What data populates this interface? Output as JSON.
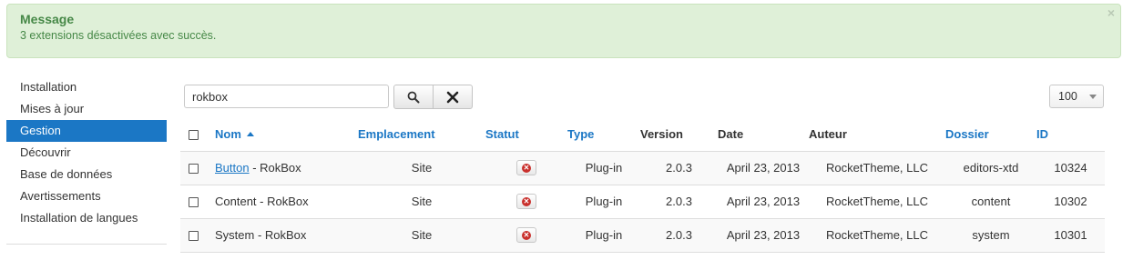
{
  "alert": {
    "heading": "Message",
    "message": "3 extensions désactivées avec succès.",
    "close": "×"
  },
  "sidebar": {
    "items": [
      {
        "label": "Installation",
        "active": false
      },
      {
        "label": "Mises à jour",
        "active": false
      },
      {
        "label": "Gestion",
        "active": true
      },
      {
        "label": "Découvrir",
        "active": false
      },
      {
        "label": "Base de données",
        "active": false
      },
      {
        "label": "Avertissements",
        "active": false
      },
      {
        "label": "Installation de langues",
        "active": false
      }
    ]
  },
  "search": {
    "value": "rokbox",
    "search_icon": "search-icon",
    "clear_icon": "close-icon"
  },
  "limit": {
    "value": "100"
  },
  "table": {
    "headers": {
      "name": "Nom",
      "location": "Emplacement",
      "status": "Statut",
      "type": "Type",
      "version": "Version",
      "date": "Date",
      "author": "Auteur",
      "folder": "Dossier",
      "id": "ID"
    },
    "rows": [
      {
        "name_link": "Button",
        "name_suffix": " - RokBox",
        "location": "Site",
        "type": "Plug-in",
        "version": "2.0.3",
        "date": "April 23, 2013",
        "author": "RocketTheme, LLC",
        "folder": "editors-xtd",
        "id": "10324"
      },
      {
        "name_link": "",
        "name_suffix": "Content - RokBox",
        "location": "Site",
        "type": "Plug-in",
        "version": "2.0.3",
        "date": "April 23, 2013",
        "author": "RocketTheme, LLC",
        "folder": "content",
        "id": "10302"
      },
      {
        "name_link": "",
        "name_suffix": "System - RokBox",
        "location": "Site",
        "type": "Plug-in",
        "version": "2.0.3",
        "date": "April 23, 2013",
        "author": "RocketTheme, LLC",
        "folder": "system",
        "id": "10301"
      }
    ]
  },
  "colors": {
    "accent": "#1b77c5",
    "success_bg": "#dff0d8",
    "success_text": "#468847",
    "disabled_status": "#c9302c"
  }
}
